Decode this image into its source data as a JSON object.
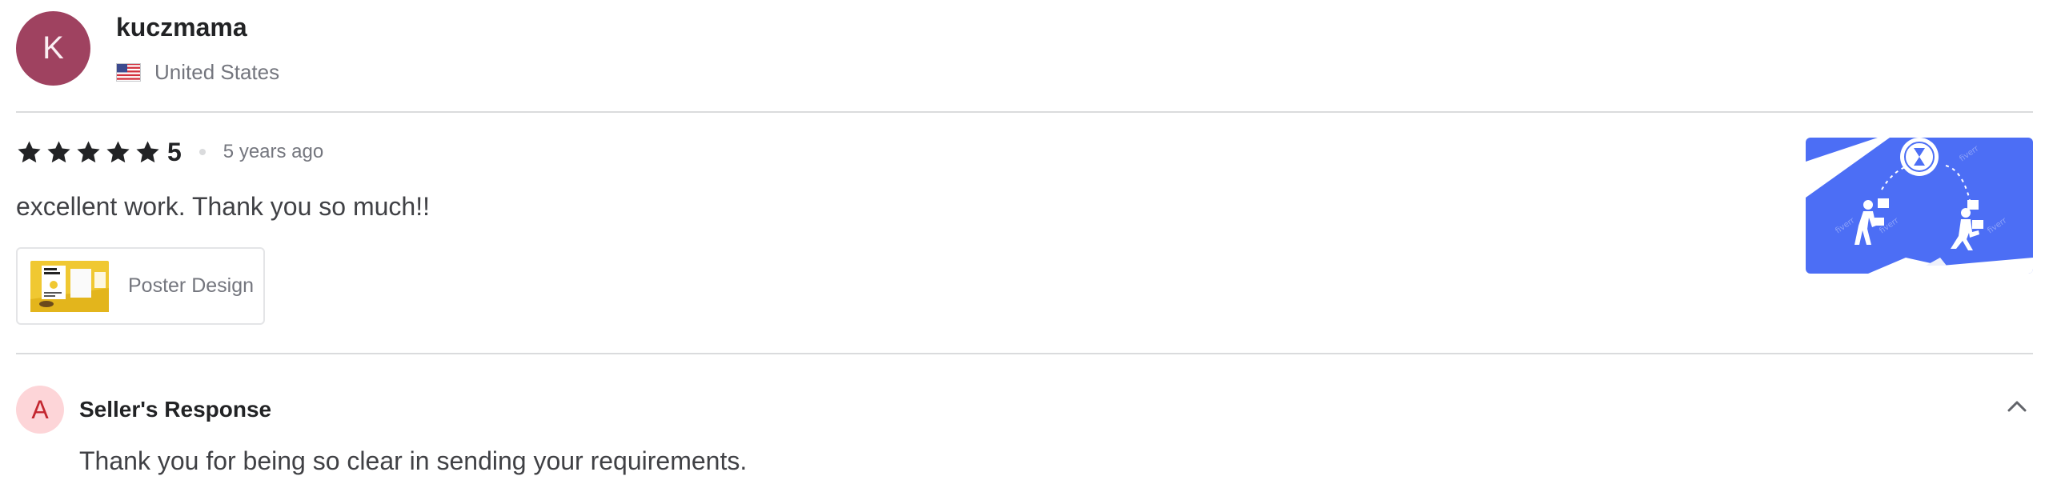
{
  "reviewer": {
    "initial": "K",
    "avatar_color": "#9f4260",
    "username": "kuczmama",
    "country": "United States",
    "flag_icon": "us-flag-icon"
  },
  "review": {
    "stars": 5,
    "rating_value": "5",
    "time_ago": "5 years ago",
    "text": "excellent work. Thank you so much!!",
    "gig": {
      "title": "Poster Design",
      "thumbnail_icon": "poster-design-thumbnail"
    },
    "delivery_image": "fiverr-delivery-illustration",
    "accent_color": "#4c6ef5"
  },
  "seller_response": {
    "initial": "A",
    "avatar_bg": "#fdd5d8",
    "avatar_text_color": "#c3262f",
    "title": "Seller's Response",
    "text": "Thank you for being so clear in sending your requirements.",
    "toggle_icon": "chevron-up-icon"
  }
}
